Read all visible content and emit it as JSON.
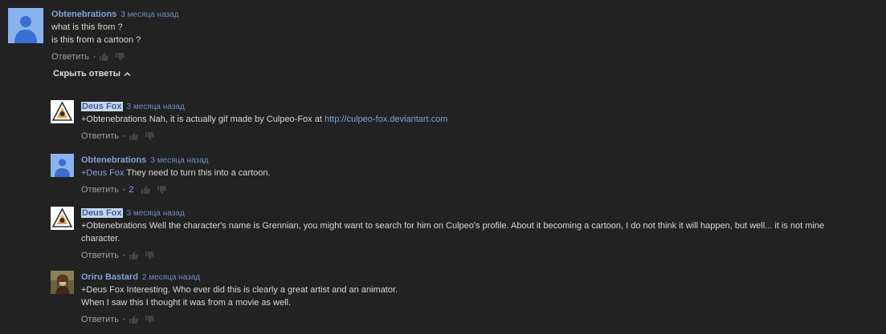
{
  "colors": {
    "background": "#222222",
    "author": "#7ea2d6",
    "text": "#d8d8d8",
    "muted": "#9a9a9a"
  },
  "top_comment": {
    "author": "Obtenebrations",
    "time": "3 месяца назад",
    "lines": [
      "what is this from ?",
      "is this from a cartoon ?"
    ],
    "reply_label": "Ответить",
    "avatar_icon": "default-user-icon"
  },
  "toggle": {
    "label": "Скрыть ответы",
    "icon": "chevron-up-icon"
  },
  "replies": [
    {
      "author": "Deus Fox",
      "time": "3 месяца назад",
      "mention": "+Obtenebrations",
      "text": " Nah, it is actually gif made by Culpeo-Fox at ",
      "link": "http://culpeo-fox.deviantart.com",
      "reply_label": "Ответить",
      "avatar_icon": "logo-avatar-icon"
    },
    {
      "author": "Obtenebrations",
      "time": "3 месяца назад",
      "mention": "+Deus Fox",
      "text": " They need to turn this into a cartoon.",
      "reply_label": "Ответить",
      "likes": "2",
      "avatar_icon": "default-user-icon"
    },
    {
      "author": "Deus Fox",
      "time": "3 месяца назад",
      "mention": "",
      "text_line1": "+Obtenebrations Well the character's name is Grennian, you might want to search for him on Culpeo's profile. About it becoming a cartoon, I do not think it will happen, but well... it is not mine",
      "text_line2": "character.",
      "reply_label": "Ответить",
      "avatar_icon": "logo-avatar-icon"
    },
    {
      "author": "Oriru Bastard",
      "time": "2 месяца назад",
      "text_line1": "+Deus Fox Interesting. Who ever did this is clearly a great artist and an animator.",
      "text_line2": "When I saw this I thought it was from a movie as well.",
      "reply_label": "Ответить",
      "avatar_icon": "photo-avatar-icon"
    }
  ]
}
